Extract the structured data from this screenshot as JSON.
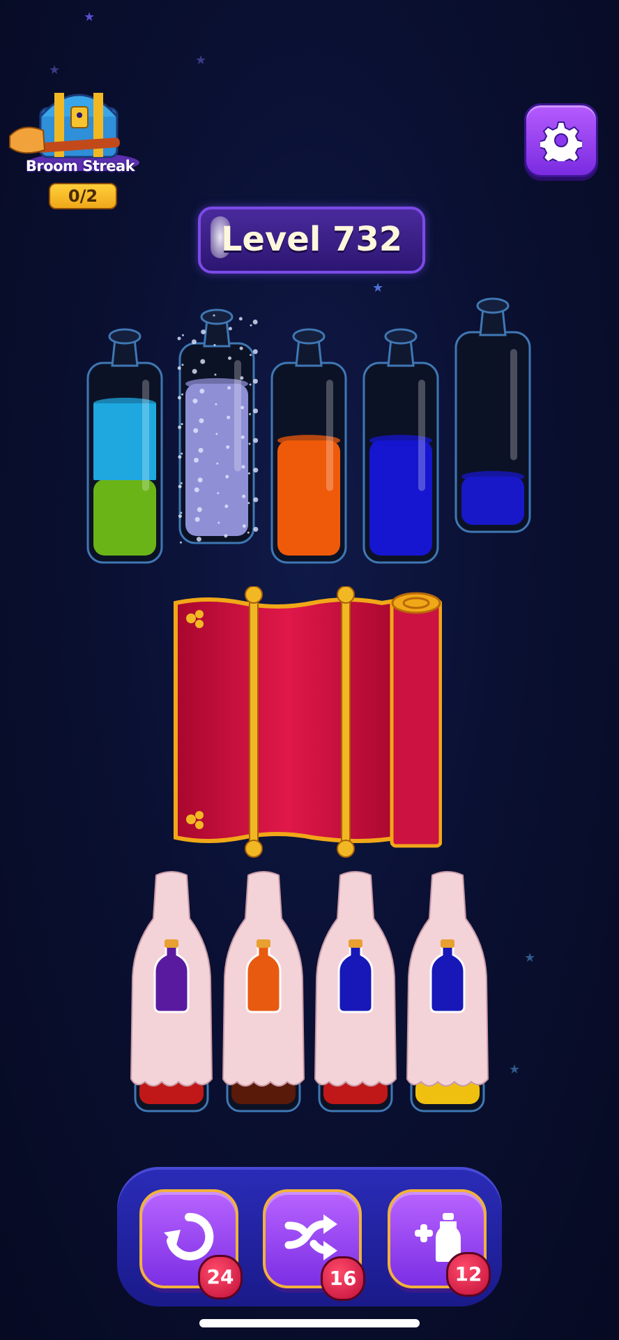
{
  "streak": {
    "label": "Broom Streak",
    "count": "0/2",
    "icon": "treasure-chest-broom-icon"
  },
  "settings": {
    "icon": "gear-icon"
  },
  "level": {
    "label": "Level 732"
  },
  "tubes": [
    {
      "name": "tube-1",
      "layers_bottom_to_top": [
        "#6bb418",
        "#1fa8e0"
      ],
      "fill_fraction": 0.82
    },
    {
      "name": "tube-2",
      "state": "sparkle-hidden",
      "layers_bottom_to_top": [
        "#8f8fd6"
      ],
      "fill_fraction": 0.82
    },
    {
      "name": "tube-3",
      "layers_bottom_to_top": [
        "#ef5a0a"
      ],
      "fill_fraction": 0.62
    },
    {
      "name": "tube-4",
      "layers_bottom_to_top": [
        "#1616d0"
      ],
      "fill_fraction": 0.62
    },
    {
      "name": "tube-5",
      "layers_bottom_to_top": [
        "#1818c8"
      ],
      "fill_fraction": 0.26
    }
  ],
  "covered_bottles": [
    {
      "hint_color": "#5a1aa0",
      "base_color": "#c01818"
    },
    {
      "hint_color": "#e85a10",
      "base_color": "#5a1a0a"
    },
    {
      "hint_color": "#1818b8",
      "base_color": "#c01818"
    },
    {
      "hint_color": "#1818b8",
      "base_color": "#f0c010"
    }
  ],
  "boosters": [
    {
      "name": "undo",
      "icon": "undo-icon",
      "count": "24"
    },
    {
      "name": "shuffle",
      "icon": "shuffle-icon",
      "count": "16"
    },
    {
      "name": "add-bottle",
      "icon": "add-bottle-icon",
      "count": "12"
    }
  ]
}
